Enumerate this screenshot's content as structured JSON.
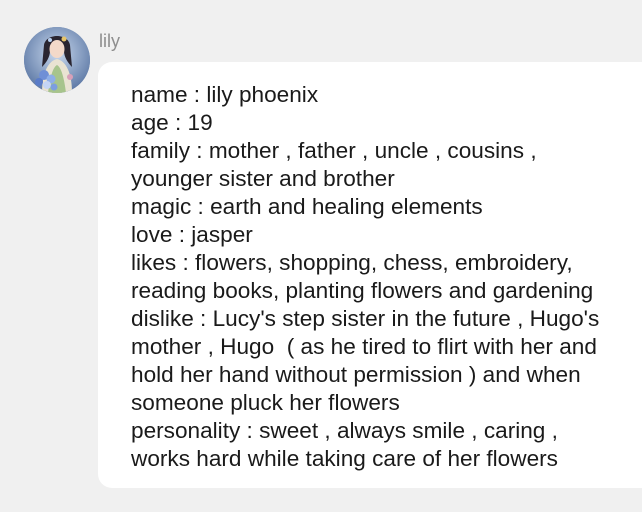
{
  "message": {
    "sender": "lily",
    "avatar_icon": "character-portrait-icon",
    "lines": [
      "name : lily phoenix",
      "age : 19",
      "family : mother , father , uncle , cousins ,",
      "younger sister and brother",
      "magic : earth and healing elements",
      "love : jasper",
      "likes : flowers, shopping, chess, embroidery,",
      "reading books, planting flowers and gardening",
      "dislike : Lucy's step sister in the future , Hugo's",
      "mother , Hugo  ( as he tired to flirt with her and",
      "hold her hand without permission ) and when",
      "someone pluck her flowers",
      "personality : sweet , always smile , caring ,",
      "works hard while taking care of her flowers"
    ]
  },
  "colors": {
    "background": "#f0f0f0",
    "bubble": "#ffffff",
    "text": "#1a1a1a",
    "username": "#8e8e8e"
  }
}
